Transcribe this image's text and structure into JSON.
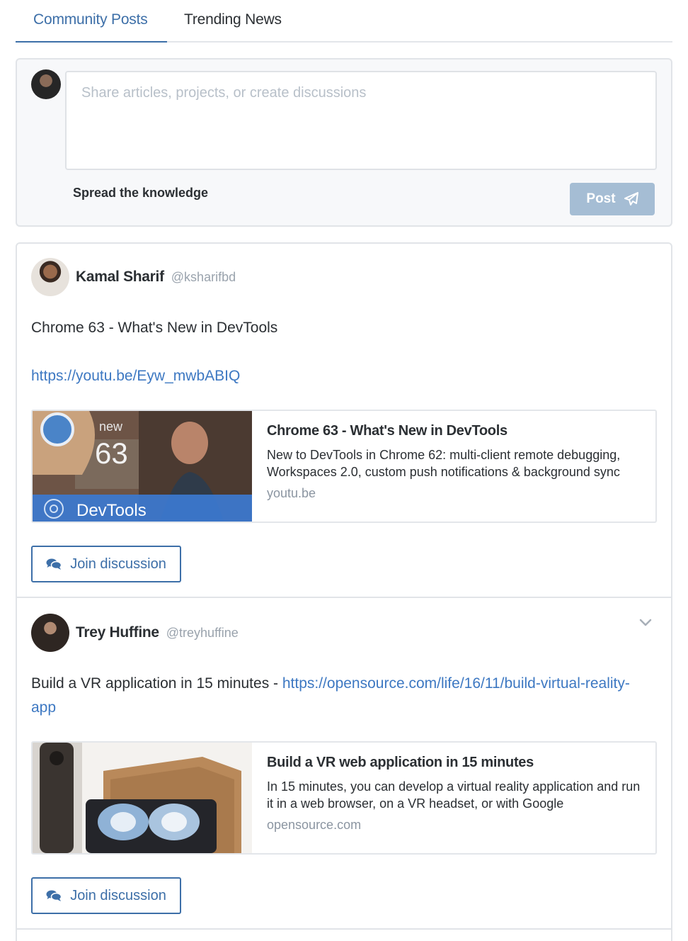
{
  "tabs": [
    {
      "label": "Community Posts",
      "active": true
    },
    {
      "label": "Trending News",
      "active": false
    }
  ],
  "composer": {
    "placeholder": "Share articles, projects, or create discussions",
    "hint": "Spread the knowledge",
    "post_label": "Post"
  },
  "posts": [
    {
      "author": "Kamal Sharif",
      "handle": "@ksharifbd",
      "text": "Chrome 63 - What's New in DevTools",
      "link": "https://youtu.be/Eyw_mwbABIQ",
      "card": {
        "title": "Chrome 63 - What's New in DevTools",
        "description": "New to DevTools in Chrome 62: multi-client remote debugging, Workspaces 2.0, custom push notifications & background sync",
        "domain": "youtu.be",
        "thumb_badge": "new",
        "thumb_number": "63",
        "thumb_caption": "DevTools"
      },
      "join_label": "Join discussion"
    },
    {
      "author": "Trey Huffine",
      "handle": "@treyhuffine",
      "text": "Build a VR application in 15 minutes - ",
      "link": "https://opensource.com/life/16/11/build-virtual-reality-app",
      "card": {
        "title": "Build a VR web application in 15 minutes",
        "description": "In 15 minutes, you can develop a virtual reality application and run it in a web browser, on a VR headset, or with Google",
        "domain": "opensource.com"
      },
      "join_label": "Join discussion"
    }
  ],
  "colors": {
    "accent": "#3d6fa8",
    "link": "#3d78c2",
    "post_button": "#a5bdd4",
    "muted": "#9aa3ad"
  },
  "icons": {
    "post_button": "paper-plane-icon",
    "join_button": "comments-icon",
    "post_menu": "chevron-down-icon"
  }
}
